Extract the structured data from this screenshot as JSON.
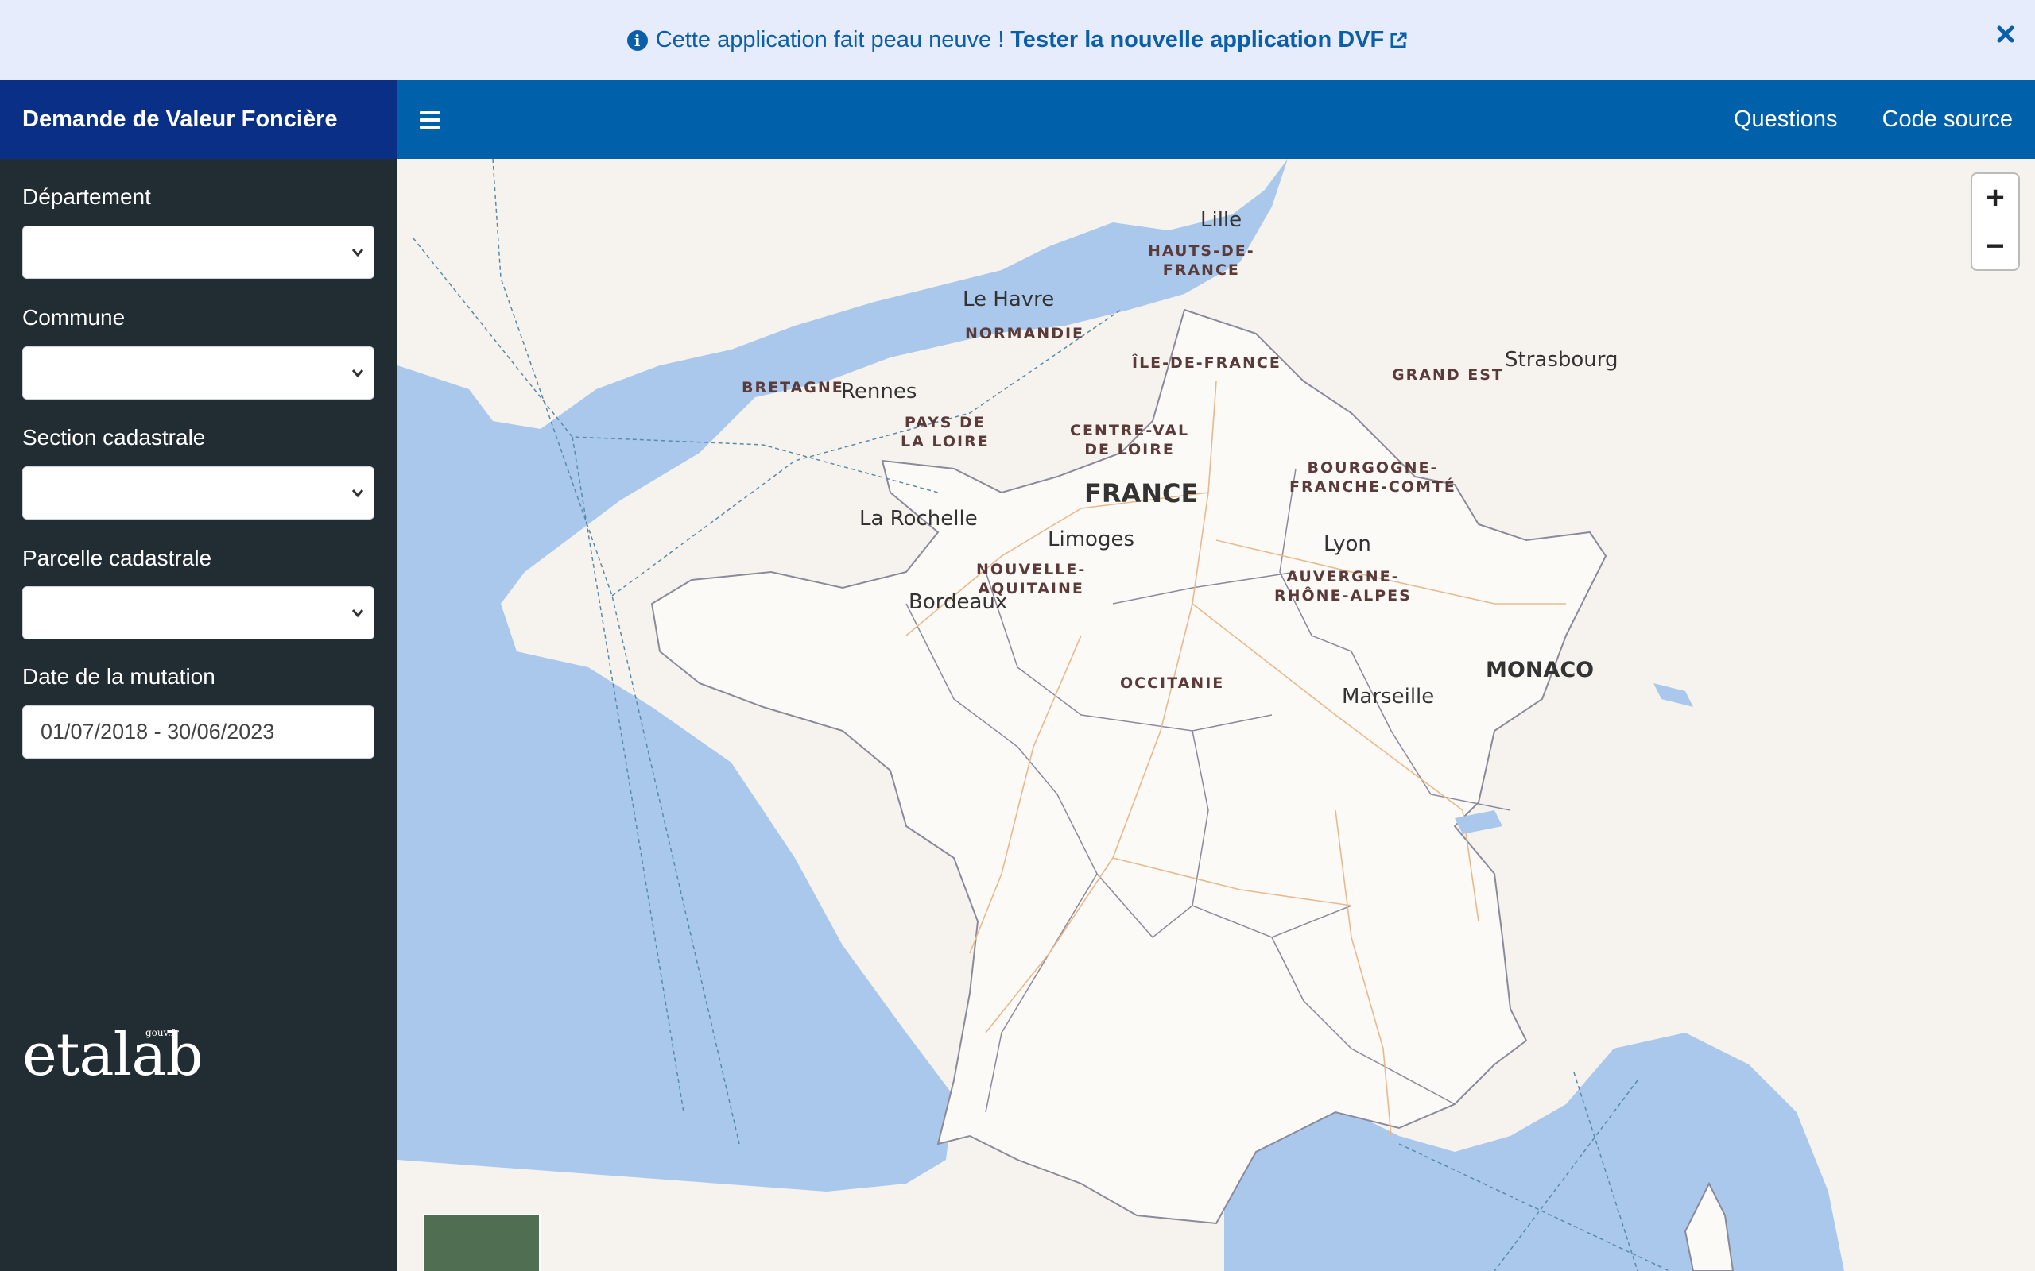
{
  "banner": {
    "message": "Cette application fait peau neuve !",
    "link_label": "Tester la nouvelle application DVF",
    "info_icon": "i"
  },
  "brand": {
    "title": "Demande de Valeur Foncière"
  },
  "nav": {
    "questions": "Questions",
    "source": "Code source"
  },
  "sidebar": {
    "departement_label": "Département",
    "commune_label": "Commune",
    "section_label": "Section cadastrale",
    "parcelle_label": "Parcelle cadastrale",
    "date_label": "Date de la mutation",
    "date_value": "01/07/2018 - 30/06/2023",
    "logo_text": "etalab",
    "logo_sup": "gouv.fr"
  },
  "map": {
    "cities": {
      "lille": "Lille",
      "le_havre": "Le Havre",
      "rennes": "Rennes",
      "strasbourg": "Strasbourg",
      "la_rochelle": "La Rochelle",
      "limoges": "Limoges",
      "lyon": "Lyon",
      "bordeaux": "Bordeaux",
      "marseille": "Marseille",
      "monaco": "MONACO"
    },
    "regions": {
      "hdf_1": "HAUTS-DE-",
      "hdf_2": "FRANCE",
      "normandie": "NORMANDIE",
      "idf": "ÎLE-DE-FRANCE",
      "grand_est": "GRAND EST",
      "bretagne": "BRETAGNE",
      "pdl_1": "PAYS DE",
      "pdl_2": "LA LOIRE",
      "cvl_1": "CENTRE-VAL",
      "cvl_2": "DE LOIRE",
      "bfc_1": "BOURGOGNE-",
      "bfc_2": "FRANCHE-COMTÉ",
      "na_1": "NOUVELLE-",
      "na_2": "AQUITAINE",
      "ara_1": "AUVERGNE-",
      "ara_2": "RHÔNE-ALPES",
      "occitanie": "OCCITANIE"
    },
    "country": "FRANCE",
    "zoom_in": "+",
    "zoom_out": "−"
  },
  "colors": {
    "sea": "#a9c8ec",
    "land": "#f6f3ee",
    "france": "#fcfaf6",
    "banner_bg": "#e6ecfb",
    "topbar": "#0060aa",
    "brand": "#0a2f87",
    "sidebar": "#222c33"
  }
}
